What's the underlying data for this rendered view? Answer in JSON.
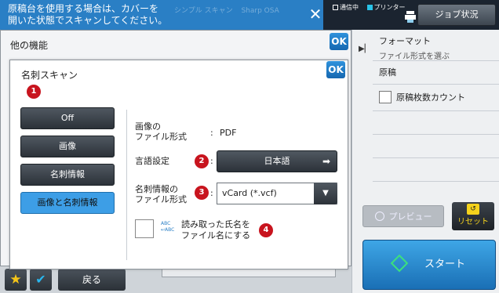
{
  "header": {
    "banner_text_line1": "原稿台を使用する場合は、カバーを",
    "banner_text_line2": "開いた状態でスキャンしてください。",
    "ghost_item1": "シンプル スキャン",
    "ghost_item2": "Sharp OSA",
    "status_comm": "通信中",
    "status_printer": "プリンター",
    "job_status_label": "ジョブ状況"
  },
  "right_panel": {
    "format_title": "フォーマット",
    "format_sub": "ファイル形式を選ぶ",
    "original_label": "原稿",
    "count_label": "原稿枚数カウント",
    "preview_label": "プレビュー",
    "reset_label": "リセット",
    "start_label": "スタート"
  },
  "bottom": {
    "back_label": "戻る"
  },
  "other_functions": {
    "title": "他の機能",
    "ok_label": "OK"
  },
  "business_card_scan": {
    "title": "名刺スキャン",
    "ok_label": "OK",
    "badges": [
      "1",
      "2",
      "3",
      "4"
    ],
    "modes": [
      {
        "label": "Off",
        "active": false
      },
      {
        "label": "画像",
        "active": false
      },
      {
        "label": "名刺情報",
        "active": false
      },
      {
        "label": "画像と名刺情報",
        "active": true
      }
    ],
    "image_format_label_line1": "画像の",
    "image_format_label_line2": "ファイル形式",
    "image_format_value": "PDF",
    "language_label": "言語設定",
    "language_value": "日本語",
    "card_format_label_line1": "名刺情報の",
    "card_format_label_line2": "ファイル形式",
    "card_format_value": "vCard (*.vcf)",
    "name_option_line1": "読み取った氏名を",
    "name_option_line2": "ファイル名にする"
  },
  "colors": {
    "banner": "#2a7fc5",
    "accent_blue": "#3d9ee6",
    "badge_red": "#c8141e",
    "reset_yellow": "#f5d31c"
  },
  "icons": {
    "banner_close": "close-icon",
    "format_arrow": "play-arrow-icon",
    "lang_arrow": "arrow-right-icon",
    "select_dropdown": "triangle-down-icon",
    "favorite": "star-icon",
    "confirm": "check-icon",
    "name_option": "abc-file-icon"
  }
}
